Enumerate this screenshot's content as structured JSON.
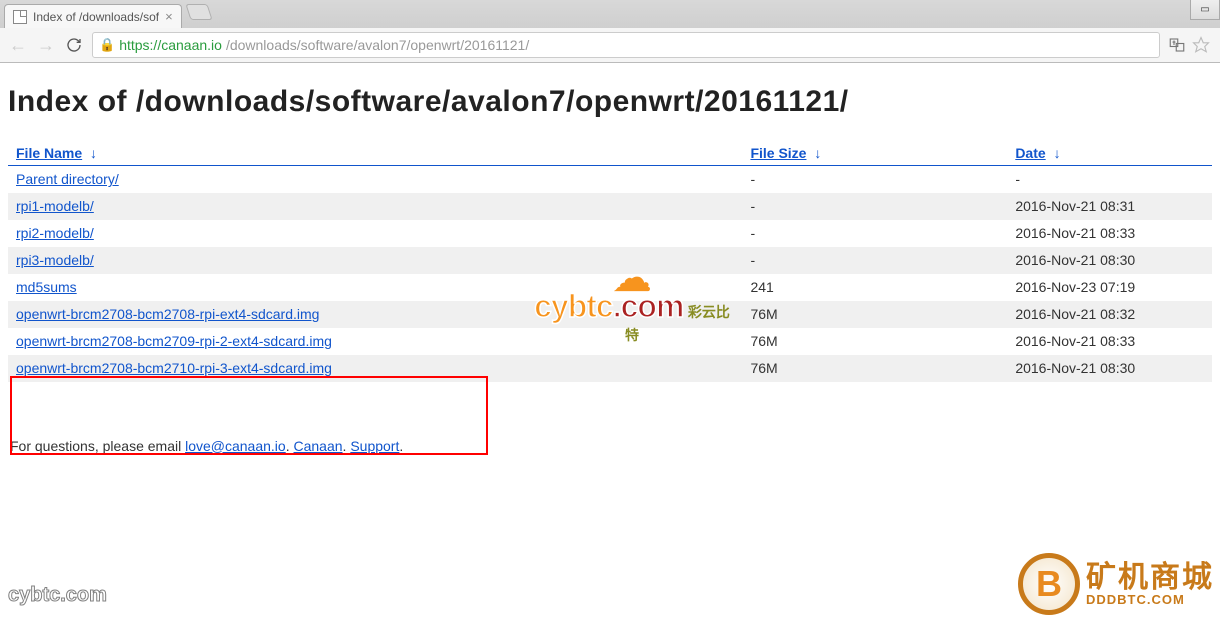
{
  "browser": {
    "tab_title": "Index of /downloads/sof",
    "url_secure": "https://canaan.io",
    "url_path": "/downloads/software/avalon7/openwrt/20161121/"
  },
  "page": {
    "heading": "Index of /downloads/software/avalon7/openwrt/20161121/"
  },
  "table": {
    "columns": {
      "name": "File Name",
      "size": "File Size",
      "date": "Date",
      "sort_arrow": "↓"
    },
    "rows": [
      {
        "name": "Parent directory/",
        "size": "-",
        "date": "-"
      },
      {
        "name": "rpi1-modelb/",
        "size": "-",
        "date": "2016-Nov-21 08:31"
      },
      {
        "name": "rpi2-modelb/",
        "size": "-",
        "date": "2016-Nov-21 08:33"
      },
      {
        "name": "rpi3-modelb/",
        "size": "-",
        "date": "2016-Nov-21 08:30"
      },
      {
        "name": "md5sums",
        "size": "241",
        "date": "2016-Nov-23 07:19"
      },
      {
        "name": "openwrt-brcm2708-bcm2708-rpi-ext4-sdcard.img",
        "size": "76M",
        "date": "2016-Nov-21 08:32"
      },
      {
        "name": "openwrt-brcm2708-bcm2709-rpi-2-ext4-sdcard.img",
        "size": "76M",
        "date": "2016-Nov-21 08:33"
      },
      {
        "name": "openwrt-brcm2708-bcm2710-rpi-3-ext4-sdcard.img",
        "size": "76M",
        "date": "2016-Nov-21 08:30"
      }
    ]
  },
  "footer": {
    "prefix": "For questions, please email ",
    "email": "love@canaan.io",
    "sep1": ". ",
    "link2": "Canaan",
    "sep2": ". ",
    "link3": "Support",
    "suffix": "."
  },
  "watermarks": {
    "cybtc_text": "cybtc",
    "cybtc_cn": "彩云比特",
    "bottom_left": "cybtc.com",
    "coin_letter": "B",
    "right_cn": "矿机商城",
    "right_en": "DDDBTC.COM"
  }
}
